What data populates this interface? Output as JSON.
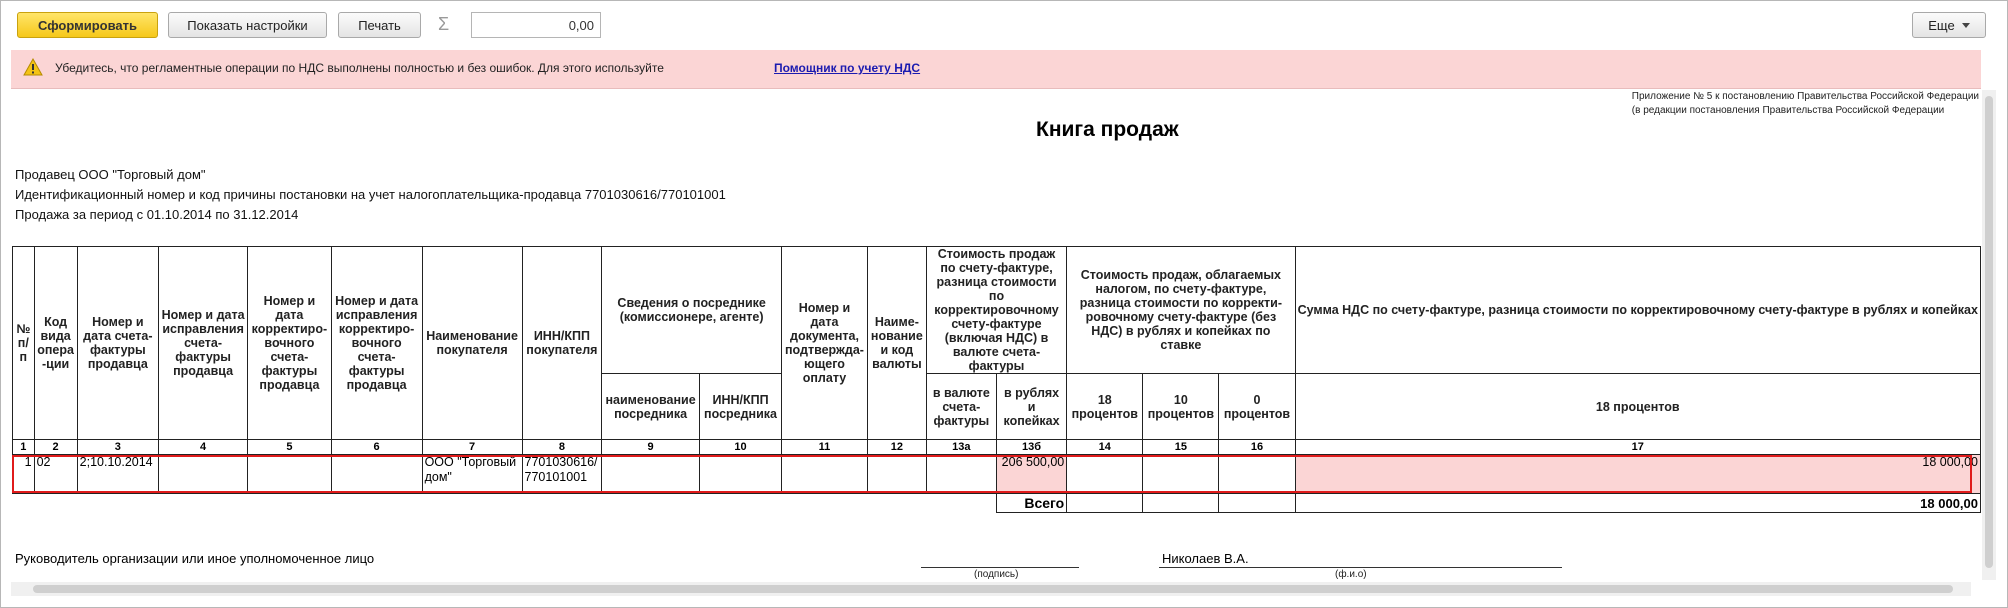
{
  "toolbar": {
    "generate_label": "Сформировать",
    "settings_label": "Показать настройки",
    "print_label": "Печать",
    "sum_icon": "sigma-icon",
    "sum_value": "0,00",
    "more_label": "Еще"
  },
  "warning": {
    "icon": "warning-icon",
    "text": "Убедитесь, что регламентные операции по НДС выполнены полностью и без ошибок. Для этого используйте",
    "link": "Помощник по учету НДС"
  },
  "report": {
    "appendix_line1": "Приложение № 5 к постановлению Правительства Российской Федерации",
    "appendix_line2": "(в редакции постановления Правительства Российской Федерации",
    "title": "Книга продаж",
    "seller": "Продавец  ООО \"Торговый дом\"",
    "inn_line": "Идентификационный номер и код причины постановки на учет налогоплательщика-продавца  7701030616/770101001",
    "period": "Продажа за период с 01.10.2014 по 31.12.2014"
  },
  "table": {
    "headers": {
      "h1": "№ п/п",
      "h2": "Код вида опера -ции",
      "h3": "Номер и дата счета-фактуры продавца",
      "h4": "Номер и дата исправления счета-фактуры продавца",
      "h5": "Номер и дата корректиро-вочного счета-фактуры продавца",
      "h6": "Номер и дата исправления корректиро-вочного счета-фактуры продавца",
      "h7": "Наименование покупателя",
      "h8": "ИНН/КПП покупателя",
      "h9_10": "Сведения о посреднике (комиссионере, агенте)",
      "h9": "наименование посредника",
      "h10": "ИНН/КПП посредника",
      "h11": "Номер и дата документа, подтвержда-ющего оплату",
      "h12": "Наиме-нование и код валюты",
      "h13": "Стоимость продаж по счету-фактуре, разница стоимости по корректировочному счету-фактуре (включая НДС) в валюте счета-фактуры",
      "h13a": "в валюте счета-фактуры",
      "h13b": "в рублях и копейках",
      "h14_16": "Стоимость продаж, облагаемых налогом, по счету-фактуре, разница стоимости по корректи-ровочному счету-фактуре (без НДС) в рублях и копейках по ставке",
      "h14": "18 процентов",
      "h15": "10 процентов",
      "h16": "0 процентов",
      "h17_top": "Сумма НДС по счету-фактуре, разница стоимости по корректировочному счету-фактуре в рублях и копейках",
      "h17": "18 процентов"
    },
    "column_numbers": [
      "1",
      "2",
      "3",
      "4",
      "5",
      "6",
      "7",
      "8",
      "9",
      "10",
      "11",
      "12",
      "13а",
      "13б",
      "14",
      "15",
      "16",
      "17"
    ],
    "rows": [
      {
        "c1": "1",
        "c2": "02",
        "c3": "2;10.10.2014",
        "c7": "ООО \"Торговый дом\"",
        "c8": "7701030616/ 770101001",
        "c13b": "206 500,00",
        "c17": "18 000,00"
      }
    ],
    "total_label": "Всего",
    "total_c17": "18 000,00"
  },
  "signatures": {
    "head_label": "Руководитель организации или иное уполномоченное лицо",
    "signature_caption": "(подпись)",
    "name": "Николаев В.А.",
    "name_caption": "(ф.и.о)"
  }
}
